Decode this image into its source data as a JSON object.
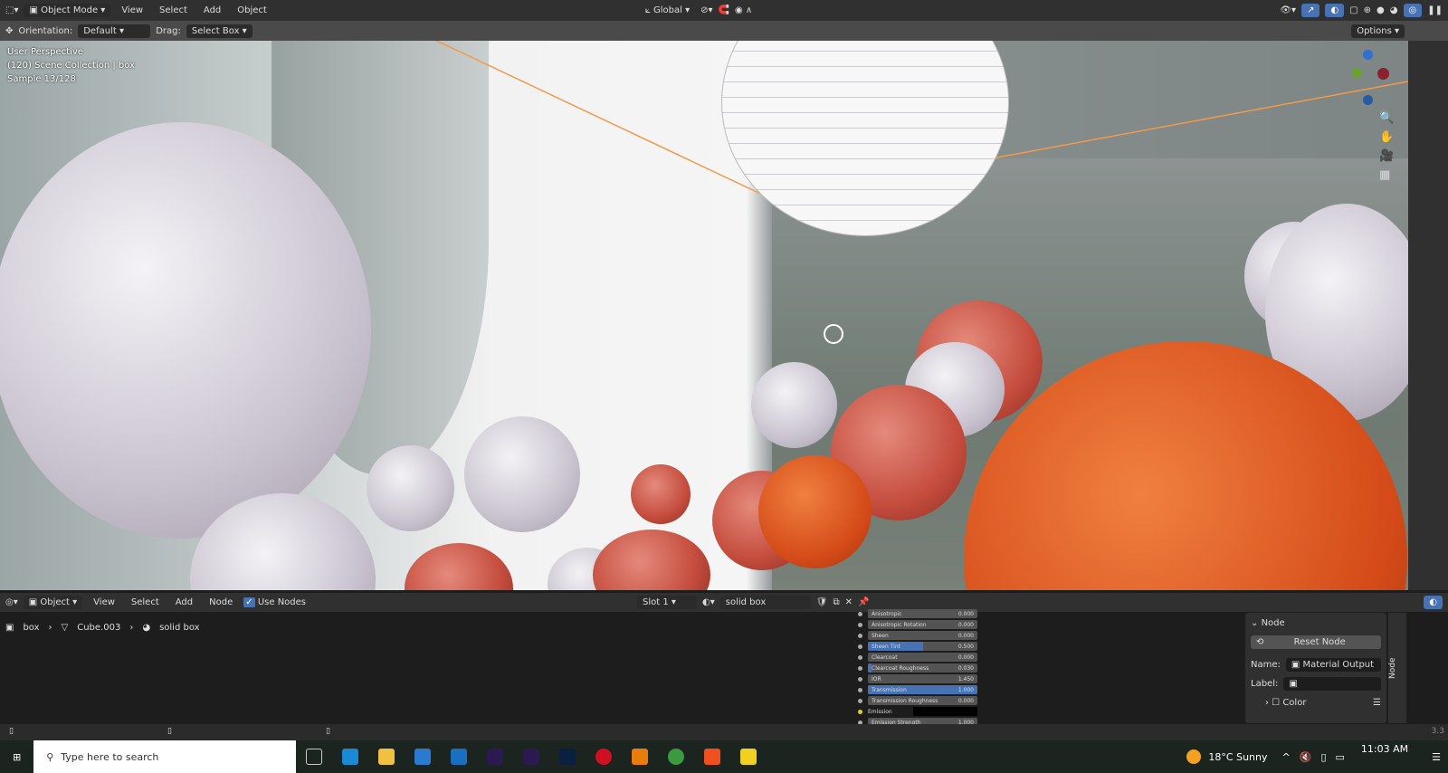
{
  "topbar": {
    "mode": "Object Mode",
    "menus": [
      "View",
      "Select",
      "Add",
      "Object"
    ],
    "transform": "Global"
  },
  "header": {
    "orientation_label": "Orientation:",
    "orientation": "Default",
    "drag_label": "Drag:",
    "drag": "Select Box",
    "options": "Options"
  },
  "viewport": {
    "perspective": "User Perspective",
    "collection": "(120) Scene Collection | box",
    "sample": "Sample 13/128"
  },
  "node_editor": {
    "type": "Object",
    "menus": [
      "View",
      "Select",
      "Add",
      "Node"
    ],
    "use_nodes": "Use Nodes",
    "slot": "Slot 1",
    "material": "solid box",
    "breadcrumb": [
      "box",
      "Cube.003",
      "solid box"
    ],
    "fields": [
      {
        "label": "Anisotropic",
        "value": "0.000",
        "fill": 0
      },
      {
        "label": "Anisotropic Rotation",
        "value": "0.000",
        "fill": 0
      },
      {
        "label": "Sheen",
        "value": "0.000",
        "fill": 0
      },
      {
        "label": "Sheen Tint",
        "value": "0.500",
        "fill": 0.5
      },
      {
        "label": "Clearcoat",
        "value": "0.000",
        "fill": 0
      },
      {
        "label": "Clearcoat Roughness",
        "value": "0.030",
        "fill": 0.03
      },
      {
        "label": "IOR",
        "value": "1.450",
        "fill": 0
      },
      {
        "label": "Transmission",
        "value": "1.000",
        "fill": 1
      },
      {
        "label": "Transmission Roughness",
        "value": "0.000",
        "fill": 0
      }
    ],
    "emission": "Emission",
    "emission_strength": {
      "label": "Emission Strength",
      "value": "1.000"
    }
  },
  "npanel": {
    "section": "Node",
    "reset": "Reset Node",
    "name_label": "Name:",
    "name": "Material Output",
    "label_label": "Label:",
    "color": "Color",
    "tab": "Node"
  },
  "status": {
    "version": "3.3"
  },
  "taskbar": {
    "search": "Type here to search",
    "weather": "18°C  Sunny",
    "time": "11:03 AM"
  }
}
